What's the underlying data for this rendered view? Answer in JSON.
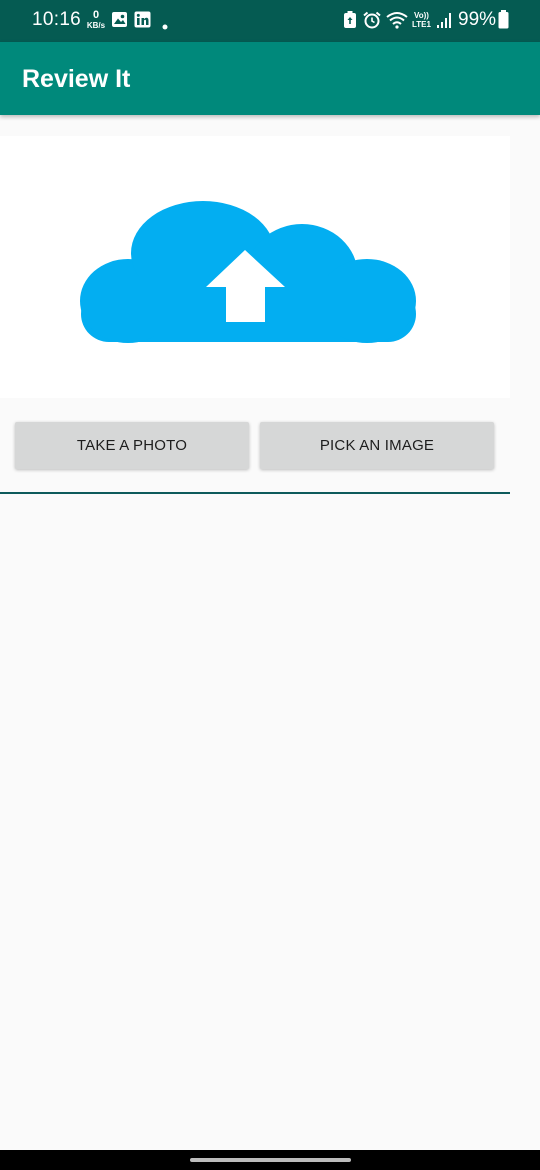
{
  "status_bar": {
    "time": "10:16",
    "network_speed_value": "0",
    "network_speed_unit": "KB/s",
    "lte_top": "Vo))",
    "lte_bottom": "LTE1",
    "battery_percent": "99%",
    "icons": [
      "gallery-icon",
      "linkedin-icon",
      "dot-icon",
      "battery-saver-icon",
      "alarm-icon",
      "wifi-icon",
      "signal-icon",
      "battery-icon"
    ]
  },
  "app_bar": {
    "title": "Review It",
    "background": "#00897b"
  },
  "image_panel": {
    "icon": "cloud-upload-icon",
    "cloud_color": "#03aef1"
  },
  "actions": {
    "take_photo_label": "TAKE A PHOTO",
    "pick_image_label": "PICK AN IMAGE"
  }
}
